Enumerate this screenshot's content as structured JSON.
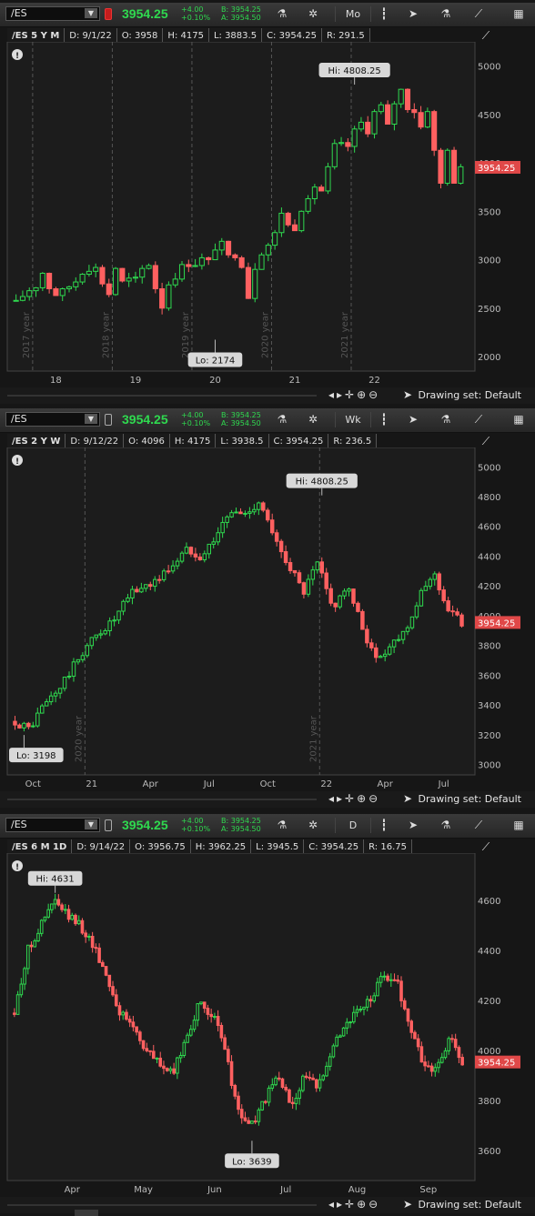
{
  "panels": [
    {
      "symbol": "/ES",
      "price": "3954.25",
      "change": "+4.00",
      "change_pct": "+0.10%",
      "bid": "B: 3954.25",
      "ask": "A: 3954.50",
      "timeframe": "Mo",
      "info": {
        "title": "/ES 5 Y M",
        "date": "D: 9/1/22",
        "open": "O: 3958",
        "high": "H: 4175",
        "low": "L: 3883.5",
        "close": "C: 3954.25",
        "range": "R: 291.5"
      },
      "drawing_set": "Drawing set: Default",
      "chart_data": {
        "type": "candlestick",
        "ylim": [
          1850,
          5250
        ],
        "yticks": [
          "5000",
          "4500",
          "4000",
          "3500",
          "3000",
          "2500",
          "2000"
        ],
        "ytick_values": [
          5000,
          4500,
          4000,
          3500,
          3000,
          2500,
          2000
        ],
        "xticks": [
          "18",
          "19",
          "20",
          "21",
          "22"
        ],
        "xtick_positions": [
          6,
          18,
          30,
          42,
          54
        ],
        "year_lines": [
          {
            "label": "2017 year",
            "pos": 3
          },
          {
            "label": "2018 year",
            "pos": 15
          },
          {
            "label": "2019 year",
            "pos": 27
          },
          {
            "label": "2020 year",
            "pos": 39
          },
          {
            "label": "2021 year",
            "pos": 51
          }
        ],
        "hi": {
          "label": "Hi: 4808.25",
          "idx": 51,
          "value": 4808.25
        },
        "lo": {
          "label": "Lo: 2174",
          "idx": 30,
          "value": 2174
        },
        "last_label": "3954.25",
        "last_value": 3954.25,
        "closes": [
          2580,
          2620,
          2680,
          2710,
          2860,
          2700,
          2630,
          2700,
          2720,
          2770,
          2850,
          2880,
          2920,
          2750,
          2640,
          2910,
          2780,
          2810,
          2820,
          2910,
          2940,
          2700,
          2500,
          2740,
          2800,
          2950,
          2930,
          2940,
          3020,
          3000,
          3100,
          3190,
          3050,
          3020,
          2920,
          2600,
          2900,
          3050,
          3150,
          3280,
          3480,
          3360,
          3300,
          3500,
          3630,
          3750,
          3710,
          3960,
          4200,
          4210,
          4170,
          4350,
          4420,
          4300,
          4530,
          4600,
          4400,
          4610,
          4760,
          4550,
          4520,
          4370,
          4530,
          4130,
          3790,
          4130,
          3790,
          3960
        ]
      }
    },
    {
      "symbol": "/ES",
      "price": "3954.25",
      "change": "+4.00",
      "change_pct": "+0.10%",
      "bid": "B: 3954.25",
      "ask": "A: 3954.50",
      "timeframe": "Wk",
      "info": {
        "title": "/ES 2 Y W",
        "date": "D: 9/12/22",
        "open": "O: 4096",
        "high": "H: 4175",
        "low": "L: 3938.5",
        "close": "C: 3954.25",
        "range": "R: 236.5"
      },
      "drawing_set": "Drawing set: Default",
      "chart_data": {
        "type": "candlestick",
        "ylim": [
          2930,
          5130
        ],
        "yticks": [
          "5000",
          "4800",
          "4600",
          "4400",
          "4200",
          "4000",
          "3800",
          "3600",
          "3400",
          "3200",
          "3000"
        ],
        "ytick_values": [
          5000,
          4800,
          4600,
          4400,
          4200,
          4000,
          3800,
          3600,
          3400,
          3200,
          3000
        ],
        "xticks": [
          "Oct",
          "21",
          "Apr",
          "Jul",
          "Oct",
          "22",
          "Apr",
          "Jul"
        ],
        "xtick_positions": [
          4,
          17,
          30,
          43,
          56,
          69,
          82,
          95
        ],
        "year_lines": [
          {
            "label": "2020 year",
            "pos": 16
          },
          {
            "label": "2021 year",
            "pos": 68
          }
        ],
        "hi": {
          "label": "Hi: 4808.25",
          "idx": 68,
          "value": 4808.25
        },
        "lo": {
          "label": "Lo: 3198",
          "idx": 2,
          "value": 3198
        },
        "last_label": "3954.25",
        "last_value": 3954.25
      }
    },
    {
      "symbol": "/ES",
      "price": "3954.25",
      "change": "+4.00",
      "change_pct": "+0.10%",
      "bid": "B: 3954.25",
      "ask": "A: 3954.50",
      "timeframe": "D",
      "info": {
        "title": "/ES 6 M 1D",
        "date": "D: 9/14/22",
        "open": "O: 3956.75",
        "high": "H: 3962.25",
        "low": "L: 3945.5",
        "close": "C: 3954.25",
        "range": "R: 16.75"
      },
      "drawing_set": "Drawing set: Default",
      "chart_data": {
        "type": "candlestick",
        "ylim": [
          3480,
          4790
        ],
        "yticks": [
          "4600",
          "4400",
          "4200",
          "4000",
          "3800",
          "3600"
        ],
        "ytick_values": [
          4600,
          4400,
          4200,
          4000,
          3800,
          3600
        ],
        "xticks": [
          "Apr",
          "May",
          "Jun",
          "Jul",
          "Aug",
          "Sep"
        ],
        "xtick_positions": [
          17,
          38,
          59,
          80,
          101,
          122
        ],
        "year_lines": [],
        "hi": {
          "label": "Hi: 4631",
          "idx": 12,
          "value": 4631
        },
        "lo": {
          "label": "Lo: 3639",
          "idx": 70,
          "value": 3639
        },
        "last_label": "3954.25",
        "last_value": 3954.25
      }
    }
  ]
}
